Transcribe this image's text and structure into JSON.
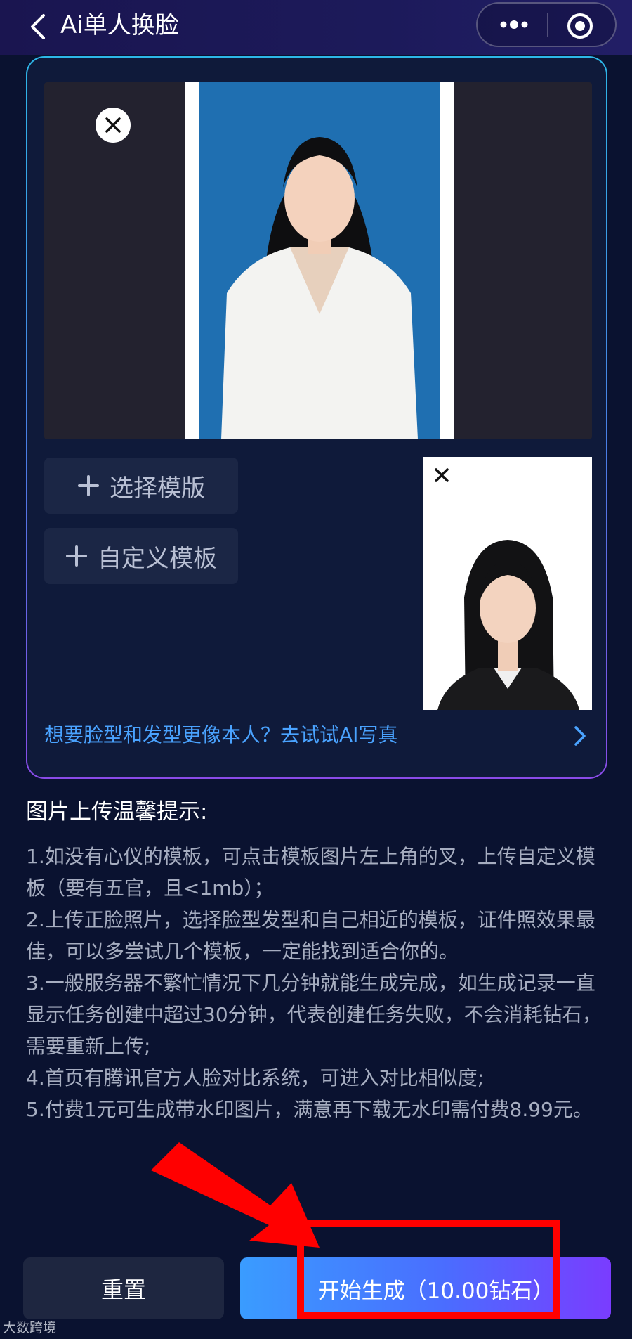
{
  "header": {
    "title": "Ai单人换脸",
    "back_icon": "chevron-left-icon",
    "more_icon": "more-dots-icon",
    "target_icon": "target-icon"
  },
  "upload": {
    "choose_template_label": "选择模版",
    "custom_template_label": "自定义模板",
    "ai_link": "想要脸型和发型更像本人？去试试AI写真"
  },
  "tips": {
    "title": "图片上传温馨提示:",
    "items": [
      "1.如没有心仪的模板，可点击模板图片左上角的叉，上传自定义模板（要有五官，且<1mb）；",
      "2.上传正脸照片，选择脸型发型和自己相近的模板，证件照效果最佳，可以多尝试几个模板，一定能找到适合你的。",
      "3.一般服务器不繁忙情况下几分钟就能生成完成，如生成记录一直显示任务创建中超过30分钟，代表创建任务失败，不会消耗钻石，需要重新上传;",
      "4.首页有腾讯官方人脸对比系统，可进入对比相似度;",
      "5.付费1元可生成带水印图片，满意再下载无水印需付费8.99元。"
    ]
  },
  "actions": {
    "reset_label": "重置",
    "start_label": "开始生成（10.00钻石）"
  },
  "watermark": "大数跨境",
  "colors": {
    "background": "#0a1230",
    "link": "#4aa3ff",
    "highlight": "#ff0000",
    "start_gradient_from": "#3a9cff",
    "start_gradient_to": "#7a3cff"
  }
}
